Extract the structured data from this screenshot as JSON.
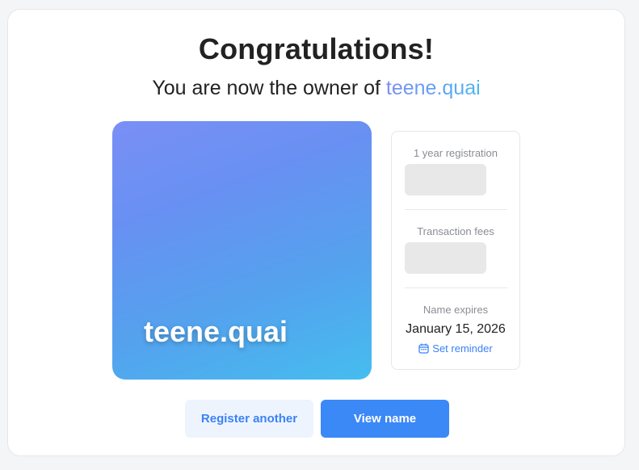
{
  "header": {
    "title": "Congratulations!",
    "subtitle_prefix": "You are now the owner of ",
    "domain": "teene.quai"
  },
  "nft_card": {
    "name": "teene.quai"
  },
  "details": {
    "registration_label": "1 year registration",
    "fees_label": "Transaction fees",
    "expires_label": "Name expires",
    "expires_date": "January 15, 2026",
    "reminder_label": "Set reminder",
    "reminder_icon": "calendar-icon"
  },
  "actions": {
    "register_another_label": "Register another",
    "view_name_label": "View name"
  },
  "colors": {
    "accent": "#3b82f6",
    "primary_button": "#3b88f7",
    "secondary_button_bg": "#eef4fe",
    "gradient_start": "#7a8ff6",
    "gradient_end": "#45bdef"
  }
}
